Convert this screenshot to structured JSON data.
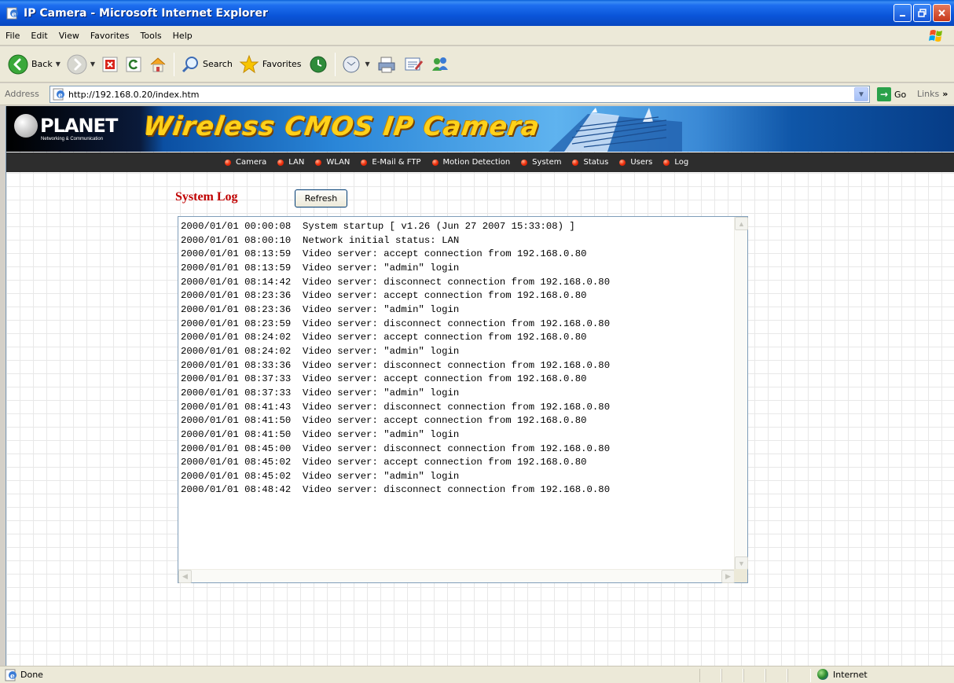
{
  "window": {
    "title": "IP Camera - Microsoft Internet Explorer"
  },
  "menu": [
    "File",
    "Edit",
    "View",
    "Favorites",
    "Tools",
    "Help"
  ],
  "toolbar": {
    "back_label": "Back",
    "search_label": "Search",
    "favorites_label": "Favorites"
  },
  "address": {
    "label": "Address",
    "url": "http://192.168.0.20/index.htm",
    "go_label": "Go",
    "links_label": "Links"
  },
  "banner": {
    "brand": "PLANET",
    "brand_sub": "Networking & Communication",
    "headline": "Wireless CMOS IP Camera"
  },
  "nav": [
    "Camera",
    "LAN",
    "WLAN",
    "E-Mail & FTP",
    "Motion Detection",
    "System",
    "Status",
    "Users",
    "Log"
  ],
  "page": {
    "title": "System Log",
    "refresh_label": "Refresh",
    "log_lines": [
      "2000/01/01 00:00:08  System startup [ v1.26 (Jun 27 2007 15:33:08) ]",
      "2000/01/01 08:00:10  Network initial status: LAN",
      "2000/01/01 08:13:59  Video server: accept connection from 192.168.0.80",
      "2000/01/01 08:13:59  Video server: \"admin\" login",
      "2000/01/01 08:14:42  Video server: disconnect connection from 192.168.0.80",
      "2000/01/01 08:23:36  Video server: accept connection from 192.168.0.80",
      "2000/01/01 08:23:36  Video server: \"admin\" login",
      "2000/01/01 08:23:59  Video server: disconnect connection from 192.168.0.80",
      "2000/01/01 08:24:02  Video server: accept connection from 192.168.0.80",
      "2000/01/01 08:24:02  Video server: \"admin\" login",
      "2000/01/01 08:33:36  Video server: disconnect connection from 192.168.0.80",
      "2000/01/01 08:37:33  Video server: accept connection from 192.168.0.80",
      "2000/01/01 08:37:33  Video server: \"admin\" login",
      "2000/01/01 08:41:43  Video server: disconnect connection from 192.168.0.80",
      "2000/01/01 08:41:50  Video server: accept connection from 192.168.0.80",
      "2000/01/01 08:41:50  Video server: \"admin\" login",
      "2000/01/01 08:45:00  Video server: disconnect connection from 192.168.0.80",
      "2000/01/01 08:45:02  Video server: accept connection from 192.168.0.80",
      "2000/01/01 08:45:02  Video server: \"admin\" login",
      "2000/01/01 08:48:42  Video server: disconnect connection from 192.168.0.80"
    ]
  },
  "status": {
    "text": "Done",
    "zone": "Internet"
  }
}
